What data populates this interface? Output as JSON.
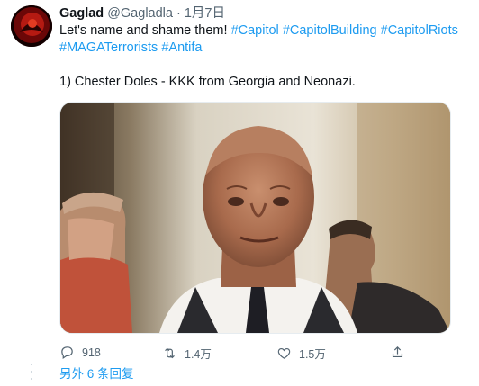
{
  "tweet": {
    "display_name": "Gaglad",
    "handle": "@Gagladla",
    "separator": "·",
    "date": "1月7日",
    "text_line1_plain": "Let's name and shame them! ",
    "hashtags_line1": [
      "#Capitol",
      "#CapitolBuilding",
      "#CapitolRiots"
    ],
    "hashtags_line2": [
      "#MAGATerrorists",
      "#Antifa"
    ],
    "paragraph2": "1) Chester Doles - KKK from Georgia and Neonazi."
  },
  "actions": {
    "replies": "918",
    "retweets": "1.4万",
    "likes": "1.5万"
  },
  "more_replies": "另外 6 条回复",
  "icons": {
    "reply": "reply-icon",
    "retweet": "retweet-icon",
    "like": "heart-icon",
    "share": "share-icon"
  },
  "colors": {
    "link": "#1d9bf0",
    "muted": "#536471"
  }
}
